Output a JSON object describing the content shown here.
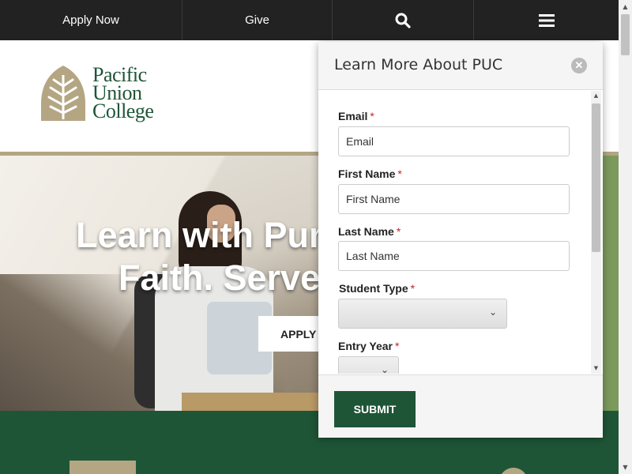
{
  "topnav": {
    "apply_label": "Apply Now",
    "give_label": "Give",
    "search_icon": "search-icon",
    "menu_icon": "hamburger-menu-icon"
  },
  "logo": {
    "lines": [
      "Pacific",
      "Union",
      "College"
    ],
    "icon": "leaf-tree-icon"
  },
  "hero": {
    "title_line1": "Learn with Pur",
    "title_line2": "Faith. Serve",
    "button_label": "APPLY N"
  },
  "modal": {
    "title": "Learn More About PUC",
    "close_icon": "close-icon",
    "fields": [
      {
        "label": "Email",
        "required_mark": "*",
        "placeholder": "Email"
      },
      {
        "label": "First Name",
        "required_mark": "*",
        "placeholder": "First Name"
      },
      {
        "label": "Last Name",
        "required_mark": "*",
        "placeholder": "Last Name"
      }
    ],
    "selects": [
      {
        "label": "Student Type",
        "required_mark": "*",
        "value": ""
      },
      {
        "label": "Entry Year",
        "required_mark": "*",
        "value": ""
      }
    ],
    "submit_label": "SUBMIT"
  },
  "colors": {
    "nav_bg": "#222222",
    "brand_green": "#1f5537",
    "brand_tan": "#b4a683",
    "required_red": "#cc2222"
  }
}
